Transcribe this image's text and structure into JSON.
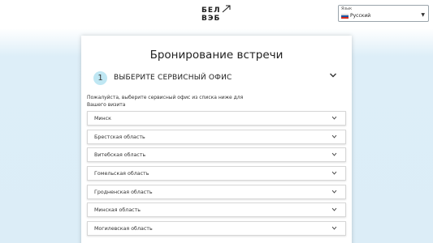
{
  "header": {
    "logo_line1": "БЕЛ",
    "logo_line2": "ВЭБ",
    "language": {
      "caption": "Язык",
      "value": "Русский",
      "flag_colors": [
        "#ffffff",
        "#1c57a5",
        "#d52b1e"
      ]
    }
  },
  "card": {
    "title": "Бронирование встречи",
    "step": {
      "number": "1",
      "title": "ВЫБЕРИТЕ СЕРВИСНЫЙ ОФИС",
      "hint": "Пожалуйста, выберите сервисный офис из списка ниже для Вашего визита"
    },
    "regions": [
      {
        "label": "Минск"
      },
      {
        "label": "Брестская область"
      },
      {
        "label": "Витебская область"
      },
      {
        "label": "Гомельская область"
      },
      {
        "label": "Гродненская область"
      },
      {
        "label": "Минская область"
      },
      {
        "label": "Могилевская область"
      }
    ]
  },
  "colors": {
    "step_badge": "#bfe7f3",
    "background": "#dcedf7"
  }
}
